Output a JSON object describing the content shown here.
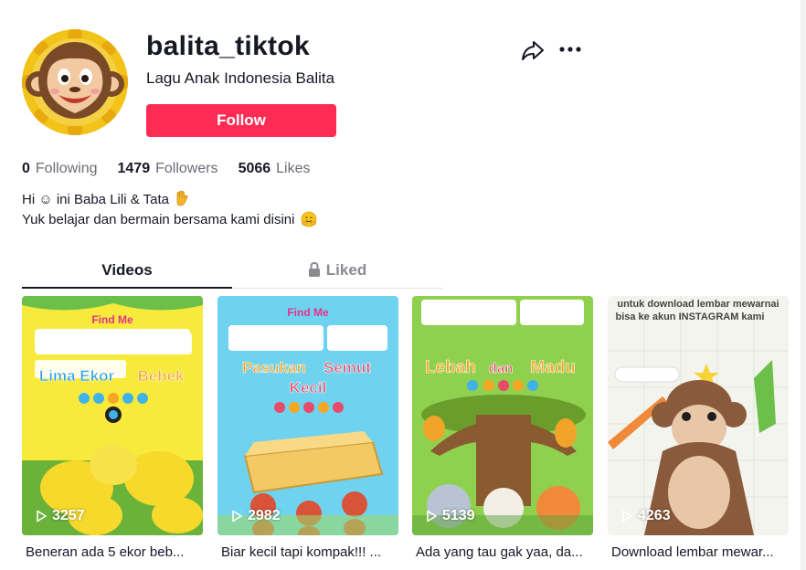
{
  "profile": {
    "username": "balita_tiktok",
    "nickname": "Lagu Anak Indonesia Balita",
    "follow_label": "Follow",
    "avatar_icon": "monkey-avatar-icon"
  },
  "stats": {
    "following_count": "0",
    "following_label": "Following",
    "followers_count": "1479",
    "followers_label": "Followers",
    "likes_count": "5066",
    "likes_label": "Likes"
  },
  "bio": {
    "line1": "Hi ☺ ini Baba Lili & Tata",
    "line2": "Yuk belajar dan bermain bersama kami disini"
  },
  "tabs": {
    "videos": "Videos",
    "liked": "Liked"
  },
  "videos": [
    {
      "views": "3257",
      "caption": "Beneran ada 5 ekor beb...",
      "thumb_title": [
        "Lima Ekor",
        "Bebek"
      ],
      "find_me": "Find Me",
      "colors": {
        "bg": "#f7ea3a",
        "accent": "#3fb3e8"
      }
    },
    {
      "views": "2982",
      "caption": "Biar kecil tapi kompak!!! ...",
      "thumb_title": [
        "Pasukan",
        "Semut",
        "Kecil"
      ],
      "find_me": "Find Me",
      "colors": {
        "bg": "#6fd3f0",
        "accent": "#e25a3a"
      }
    },
    {
      "views": "5139",
      "caption": "Ada yang tau gak yaa, da...",
      "thumb_title": [
        "Lebah",
        "dan",
        "Madu"
      ],
      "find_me": "",
      "colors": {
        "bg": "#8fd14f",
        "accent": "#f0a52a"
      }
    },
    {
      "views": "4263",
      "caption": "Download lembar mewar...",
      "thumb_title": [
        "untuk download lembar mewarnai",
        "bisa ke akun INSTAGRAM kami"
      ],
      "find_me": "",
      "colors": {
        "bg": "#f4f4ef",
        "accent": "#8a5a3c"
      }
    }
  ],
  "colors": {
    "brand": "#fe2c55",
    "text": "#161823",
    "muted": "#6b6d76"
  }
}
